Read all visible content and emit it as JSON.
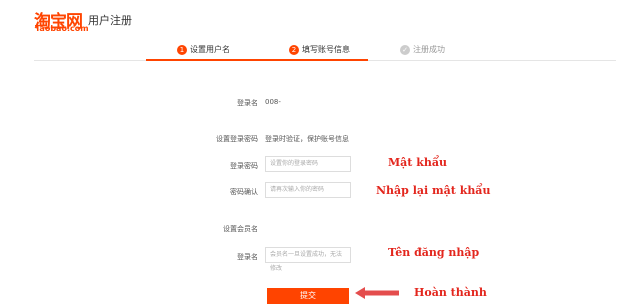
{
  "header": {
    "logo_cn": "淘宝网",
    "logo_en": "Taobao.com",
    "title": "用户注册"
  },
  "steps": [
    {
      "num": "1",
      "label": "设置用户名"
    },
    {
      "num": "2",
      "label": "填写账号信息"
    },
    {
      "num": "✓",
      "label": "注册成功"
    }
  ],
  "form": {
    "account_label": "登录名",
    "account_value": "008-",
    "password_section": "设置登录密码",
    "password_hint": "登录时验证，保护账号信息",
    "password_label": "登录密码",
    "password_placeholder": "设置你的登录密码",
    "confirm_label": "密码确认",
    "confirm_placeholder": "请再次输入你的密码",
    "member_section": "设置会员名",
    "member_label": "登录名",
    "member_placeholder": "会员名一旦设置成功，无法修改",
    "submit_label": "提交"
  },
  "annotations": {
    "password": "Mật khẩu",
    "confirm": "Nhập lại mật khẩu",
    "member": "Tên đăng nhập",
    "submit": "Hoàn thành"
  },
  "colors": {
    "accent": "#ff4400",
    "annotation": "#e3261d",
    "arrow": "#e44d4d"
  }
}
